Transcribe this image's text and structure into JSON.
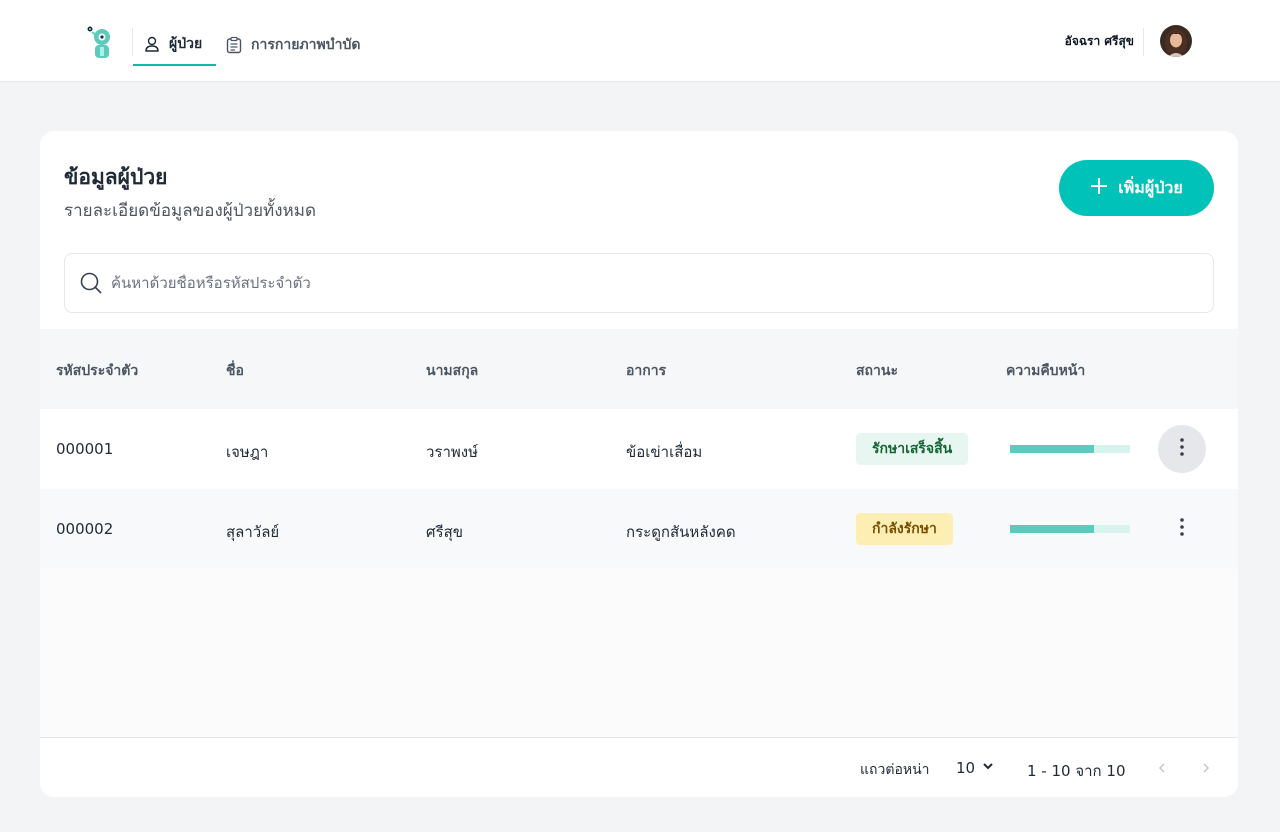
{
  "nav": {
    "tabs": [
      {
        "label": "ผู้ป่วย",
        "icon": "person-icon",
        "active": true
      },
      {
        "label": "การกายภาพบำบัด",
        "icon": "clipboard-icon",
        "active": false
      }
    ],
    "user_name": "อัจฉรา ศรีสุข"
  },
  "header": {
    "title": "ข้อมูลผู้ป่วย",
    "subtitle": "รายละเอียดข้อมูลของผู้ป่วยทั้งหมด",
    "add_button_label": "เพิ่มผู้ป่วย"
  },
  "search": {
    "placeholder": "ค้นหาด้วยชื่อหรือรหัสประจำตัว",
    "value": ""
  },
  "table": {
    "columns": [
      "รหัสประจำตัว",
      "ชื่อ",
      "นามสกุล",
      "อาการ",
      "สถานะ",
      "ความคืบหน้า"
    ],
    "rows": [
      {
        "id": "000001",
        "first_name": "เจษฎา",
        "last_name": "วราพงษ์",
        "symptom": "ข้อเข่าเสื่อม",
        "status": "รักษาเสร็จสิ้น",
        "status_type": "done",
        "progress": 0.7
      },
      {
        "id": "000002",
        "first_name": "สุลาวัลย์",
        "last_name": "ศรีสุข",
        "symptom": "กระดูกสันหลังคด",
        "status": "กำลังรักษา",
        "status_type": "in-progress",
        "progress": 0.7
      }
    ]
  },
  "pagination": {
    "rows_per_page_label": "แถวต่อหน่า",
    "rows_per_page": "10",
    "range_text": "1 - 10 จาก 10"
  },
  "colors": {
    "accent": "#00c2b8",
    "status_done_bg": "#e8f6f1",
    "status_progress_bg": "#fdeeb4"
  }
}
